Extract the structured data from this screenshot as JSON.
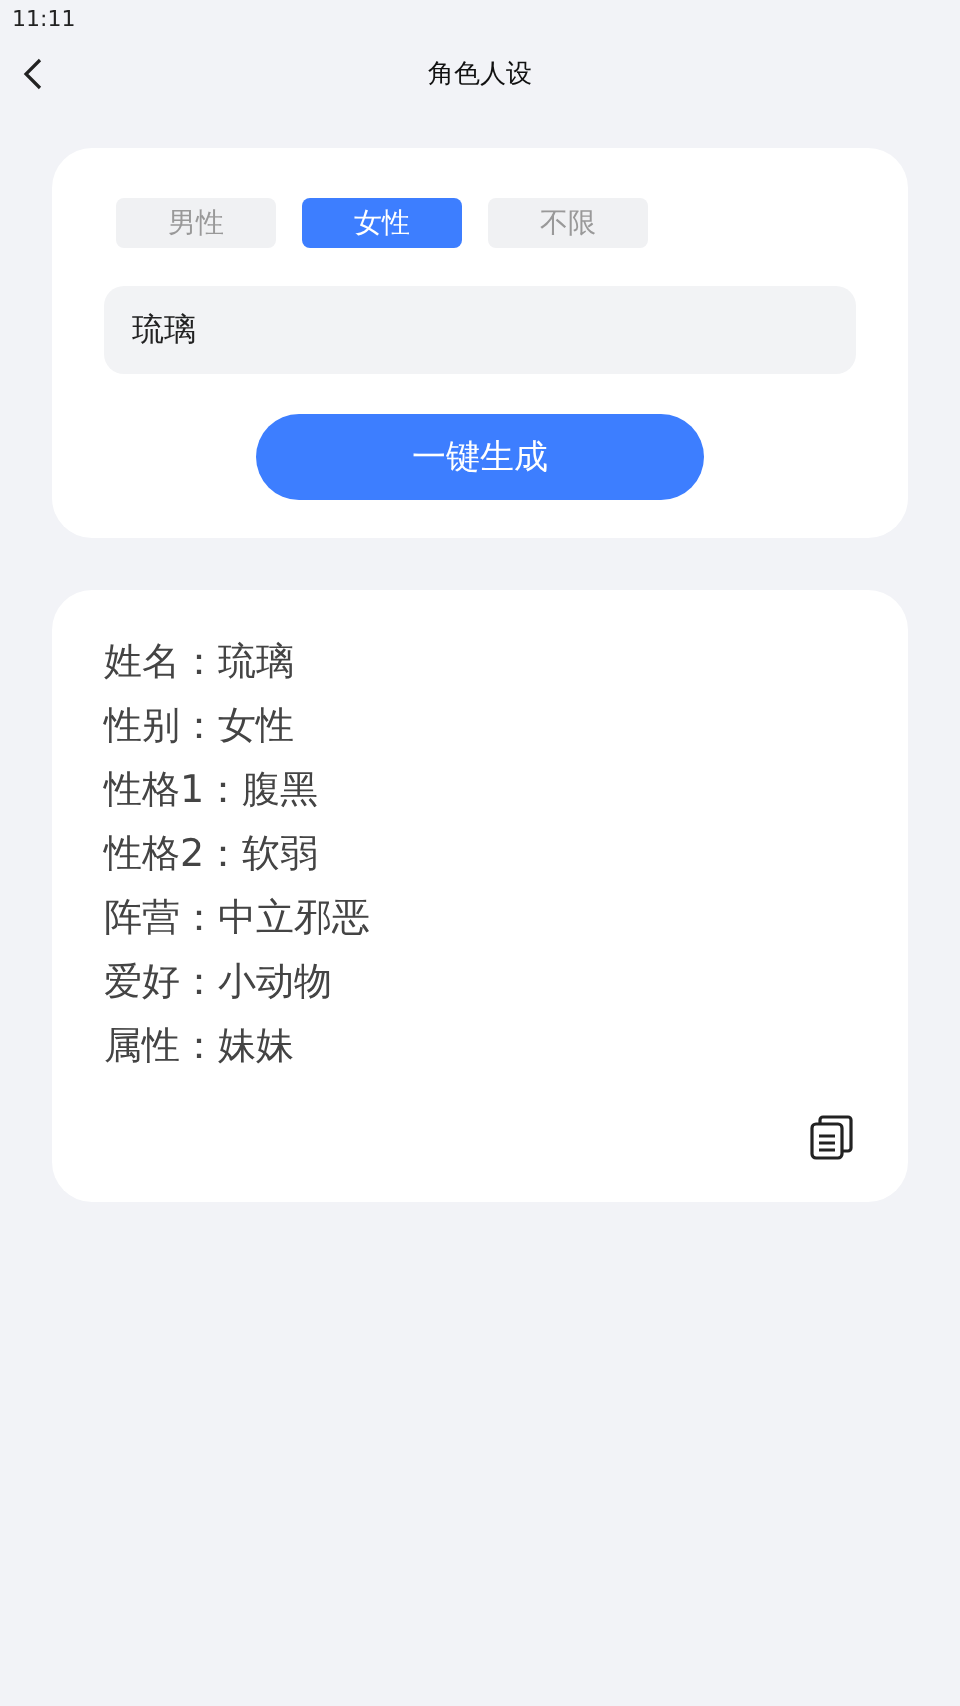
{
  "status_bar": {
    "time": "11:11"
  },
  "header": {
    "title": "角色人设"
  },
  "gender_tabs": [
    {
      "label": "男性",
      "selected": false
    },
    {
      "label": "女性",
      "selected": true
    },
    {
      "label": "不限",
      "selected": false
    }
  ],
  "name_field": {
    "value": "琉璃"
  },
  "generate_button": {
    "label": "一键生成"
  },
  "result": {
    "lines": [
      "姓名：琉璃",
      "性别：女性",
      "性格1：腹黑",
      "性格2：软弱",
      "阵营：中立邪恶",
      "爱好：小动物",
      "属性：妹妹"
    ]
  }
}
